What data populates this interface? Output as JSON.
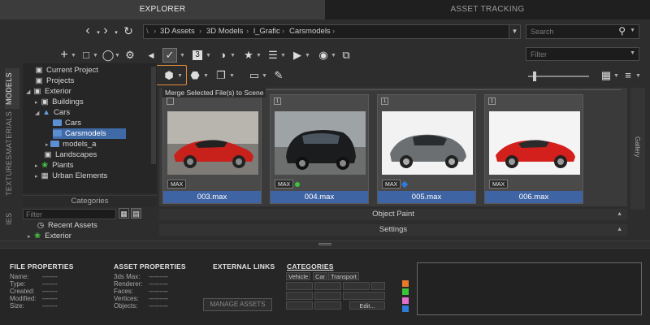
{
  "tabs": {
    "explorer": "EXPLORER",
    "asset_tracking": "ASSET TRACKING"
  },
  "nav": {
    "path_root": "\\",
    "breadcrumbs": [
      "3D Assets",
      "3D Models",
      "l_Grafic",
      "Carsmodels"
    ],
    "search_placeholder": "Search",
    "filter_placeholder": "Filter"
  },
  "tooltip": "Merge Selected File(s) to Scene",
  "side_tabs": [
    "MODELS",
    "MATERIALS",
    "TEXTURES",
    "IES"
  ],
  "tree": [
    {
      "label": "Current Project"
    },
    {
      "label": "Projects"
    },
    {
      "label": "Exterior"
    },
    {
      "label": "Buildings"
    },
    {
      "label": "Cars"
    },
    {
      "label": "Cars"
    },
    {
      "label": "Carsmodels"
    },
    {
      "label": "models_a"
    },
    {
      "label": "Landscapes"
    },
    {
      "label": "Plants"
    },
    {
      "label": "Urban Elements"
    }
  ],
  "categories_label": "Categories",
  "cat_filter_placeholder": "Filter",
  "cat_tree": [
    {
      "label": "Recent Assets"
    },
    {
      "label": "Exterior"
    }
  ],
  "assets": [
    {
      "num": "1",
      "name": "003.max",
      "badge": "MAX",
      "dot": ""
    },
    {
      "num": "1",
      "name": "004.max",
      "badge": "MAX",
      "dot": "#3ac43a"
    },
    {
      "num": "1",
      "name": "005.max",
      "badge": "MAX",
      "dot": "#2f7bd8"
    },
    {
      "num": "1",
      "name": "006.max",
      "badge": "MAX",
      "dot": ""
    }
  ],
  "strips": {
    "object_paint": "Object Paint",
    "settings": "Settings"
  },
  "gallery_label": "Gallery",
  "file_properties": {
    "title": "FILE PROPERTIES",
    "labels": [
      "Name:",
      "Type:",
      "Created:",
      "Modified:",
      "Size:"
    ],
    "values": [
      "-------",
      "-------",
      "-------",
      "-------",
      "-------"
    ]
  },
  "asset_properties": {
    "title": "ASSET PROPERTIES",
    "labels": [
      "3ds Max:",
      "Renderer:",
      "Faces:",
      "Vertices:",
      "Objects:"
    ],
    "values": [
      "---------",
      "---------",
      "---------",
      "---------",
      "---------"
    ]
  },
  "external_links": {
    "title": "EXTERNAL LINKS",
    "manage": "MANAGE ASSETS"
  },
  "categories_panel": {
    "title": "CATEGORIES",
    "tags": [
      "Vehicle",
      "Car",
      "Transport"
    ],
    "edit": "Edit...",
    "swatches": [
      "#e8782a",
      "#3ac43a",
      "#e070d0",
      "#2f7bd8"
    ]
  }
}
